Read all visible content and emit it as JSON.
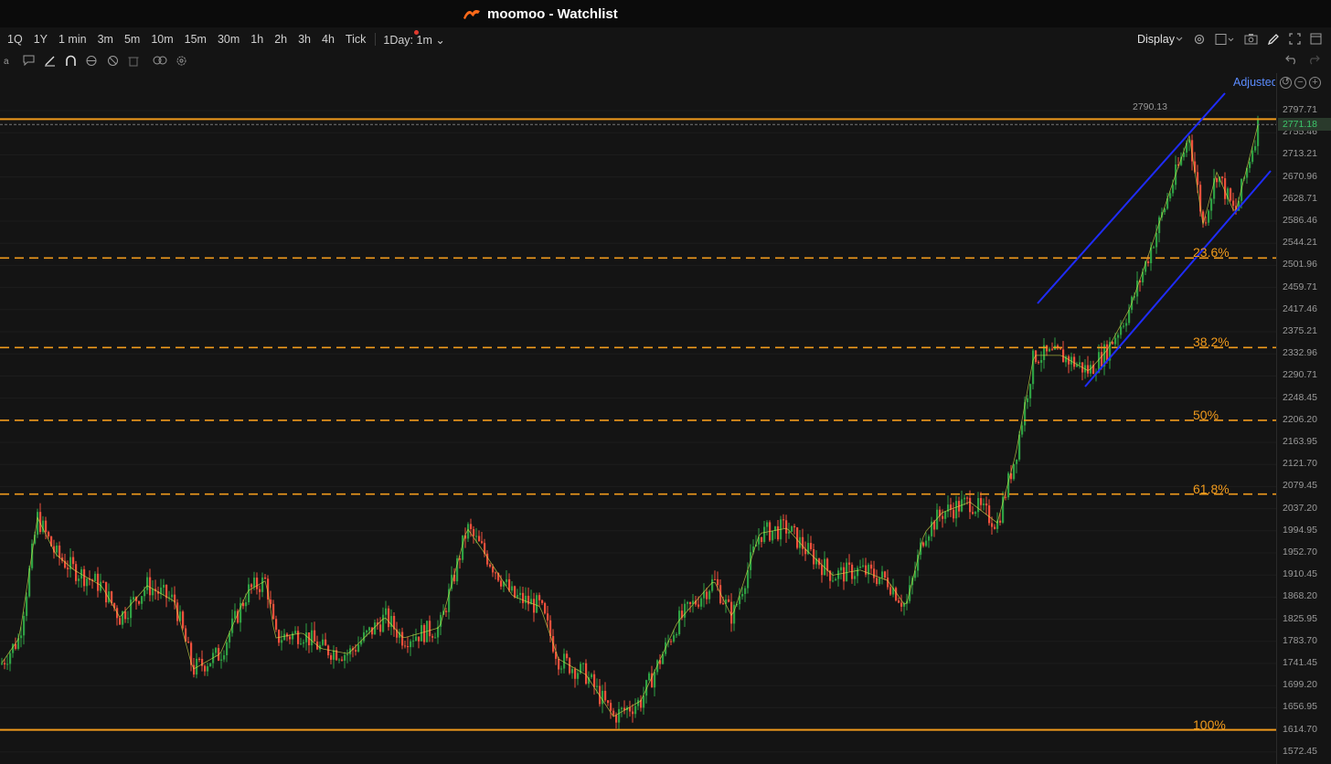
{
  "window": {
    "title": "moomoo - Watchlist"
  },
  "toolbar": {
    "periods": [
      "1Q",
      "1Y",
      "1 min",
      "3m",
      "5m",
      "10m",
      "15m",
      "30m",
      "1h",
      "2h",
      "3h",
      "4h",
      "Tick"
    ],
    "selected_period": "1Day: 1m",
    "display_label": "Display"
  },
  "chart": {
    "adjusted_label": "Adjusted",
    "peak_label": "2790.13",
    "current_price": "2771.18",
    "y_ticks": [
      "2797.71",
      "2755.46",
      "2713.21",
      "2670.96",
      "2628.71",
      "2586.46",
      "2544.21",
      "2501.96",
      "2459.71",
      "2417.46",
      "2375.21",
      "2332.96",
      "2290.71",
      "2248.45",
      "2206.20",
      "2163.95",
      "2121.70",
      "2079.45",
      "2037.20",
      "1994.95",
      "1952.70",
      "1910.45",
      "1868.20",
      "1825.95",
      "1783.70",
      "1741.45",
      "1699.20",
      "1656.95",
      "1614.70",
      "1572.45"
    ],
    "fib_levels": [
      {
        "label": "23.6%",
        "price": 2516
      },
      {
        "label": "38.2%",
        "price": 2345
      },
      {
        "label": "50%",
        "price": 2206
      },
      {
        "label": "61.8%",
        "price": 2065
      },
      {
        "label": "100%",
        "price": 1614.7
      }
    ],
    "top_level_price": 2790.13,
    "colors": {
      "up": "#2ea043",
      "down": "#f0503c",
      "fib": "#f09a1c",
      "channel": "#1f2cff",
      "ma": "#d4e04a"
    },
    "icons": [
      "settings-icon",
      "layout-icon",
      "camera-icon",
      "pen-icon",
      "fullscreen-icon",
      "window-icon",
      "undo-icon",
      "redo-icon"
    ]
  }
}
